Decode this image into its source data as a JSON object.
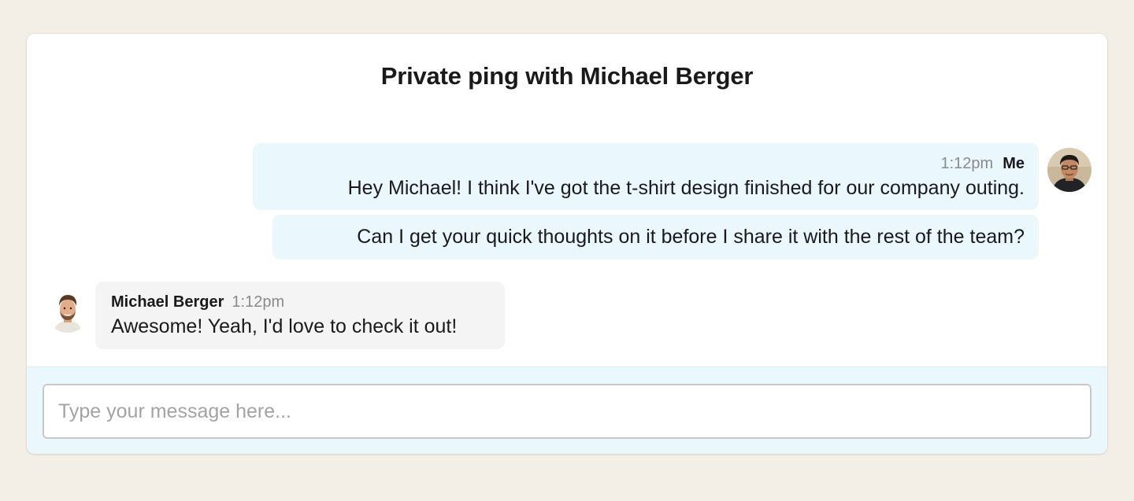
{
  "chat": {
    "title": "Private ping with Michael Berger"
  },
  "messages": [
    {
      "sender": "Me",
      "time": "1:12pm",
      "text": "Hey Michael! I think I've got the t-shirt design finished for our company outing."
    },
    {
      "sender": "Me",
      "text": "Can I get your quick thoughts on it before I share it with the rest of the team?"
    },
    {
      "sender": "Michael Berger",
      "time": "1:12pm",
      "text": "Awesome! Yeah, I'd love to check it out!"
    }
  ],
  "composer": {
    "placeholder": "Type your message here...",
    "value": ""
  },
  "colors": {
    "page_background": "#f3efe6",
    "my_bubble": "#eaf7fd",
    "their_bubble": "#f4f4f4",
    "composer_background": "#eaf7fd"
  },
  "icons": {
    "my_avatar": "avatar-me-icon",
    "their_avatar": "avatar-michael-berger-icon"
  }
}
